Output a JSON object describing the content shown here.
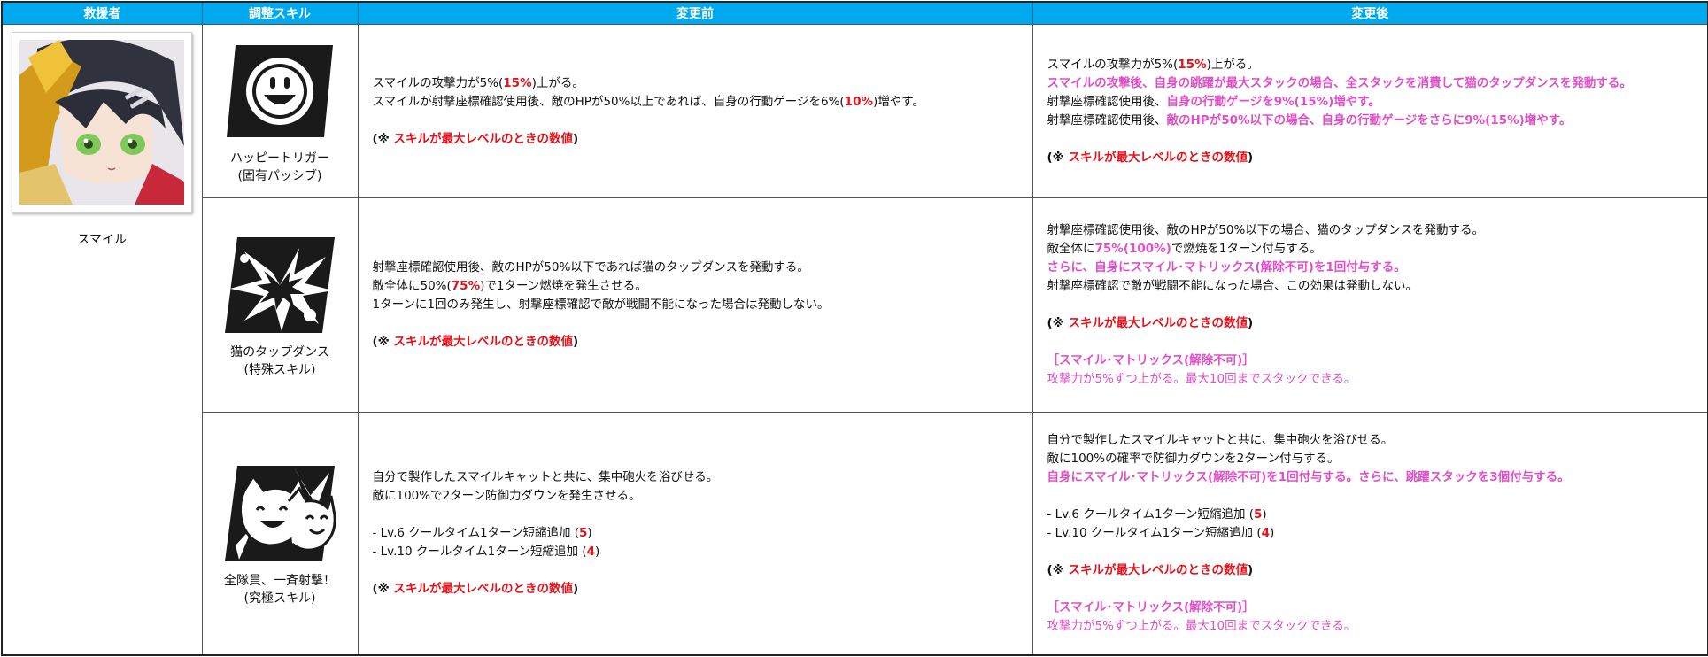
{
  "headers": [
    "救援者",
    "調整スキル",
    "変更前",
    "変更後"
  ],
  "rescuer": {
    "name": "スマイル",
    "portrait": "character-portrait"
  },
  "note": {
    "prefix": "(※ ",
    "emph": "スキルが最大レベルのときの数値",
    "suffix": ")"
  },
  "skills": [
    {
      "icon": "smiley-icon",
      "name": "ハッピートリガー",
      "type": "(固有パッシブ)",
      "before": [
        [
          "スマイルの攻撃力が5%(",
          "15%",
          ")上がる。"
        ],
        [
          "スマイルが射撃座標確認使用後、敵のHPが50%以上であれば、自身の行動ゲージを6%(",
          "10%",
          ")増やす。"
        ]
      ],
      "after": [
        [
          "スマイルの攻撃力が5%(",
          "15%",
          ")上がる。"
        ],
        "スマイルの攻撃後、自身の跳躍が最大スタックの場合、全スタックを消費して猫のタップダンスを発動する。",
        [
          "射撃座標確認使用後、",
          "自身の行動ゲージを9%(15%)増やす。"
        ],
        [
          "射撃座標確認使用後、",
          "敵のHPが50%以下の場合、自身の行動ゲージをさらに9%(15%)増やす。"
        ]
      ]
    },
    {
      "icon": "burst-icon",
      "name": "猫のタップダンス",
      "type": "(特殊スキル)",
      "before": [
        "射撃座標確認使用後、敵のHPが50%以下であれば猫のタップダンスを発動する。",
        [
          "敵全体に50%(",
          "75%",
          ")で1ターン燃焼を発生させる。"
        ],
        "1ターンに1回のみ発生し、射撃座標確認で敵が戦闘不能になった場合は発動しない。"
      ],
      "after": [
        "射撃座標確認使用後、敵のHPが50%以下の場合、猫のタップダンスを発動する。",
        [
          "敵全体に",
          "75%(100%)",
          "で燃焼を1ターン付与する。"
        ],
        "さらに、自身にスマイル･マトリックス(解除不可)を1回付与する。",
        "射撃座標確認で敵が戦闘不能になった場合、この効果は発動しない。"
      ],
      "after_extra": {
        "title": "［スマイル･マトリックス(解除不可)］",
        "desc": "攻撃力が5%ずつ上がる。最大10回までスタックできる。"
      }
    },
    {
      "icon": "cats-icon",
      "name": "全隊員、一斉射撃！",
      "type": "(究極スキル)",
      "before": [
        "自分で製作したスマイルキャットと共に、集中砲火を浴びせる。",
        "敵に100%で2ターン防御力ダウンを発生させる。",
        "",
        [
          "- Lv.6 クールタイム1ターン短縮追加 (",
          "5",
          ")"
        ],
        [
          "- Lv.10  クールタイム1ターン短縮追加 (",
          "4",
          ")"
        ]
      ],
      "after": [
        "自分で製作したスマイルキャットと共に、集中砲火を浴びせる。",
        "敵に100%の確率で防御力ダウンを2ターン付与する。",
        "自身にスマイル･マトリックス(解除不可)を1回付与する。さらに、跳躍スタックを3個付与する。",
        "",
        [
          "- Lv.6 クールタイム1ターン短縮追加 (",
          "5",
          ")"
        ],
        [
          "- Lv.10  クールタイム1ターン短縮追加 (",
          "4",
          ")"
        ]
      ],
      "after_extra": {
        "title": "［スマイル･マトリックス(解除不可)］",
        "desc": "攻撃力が5%ずつ上がる。最大10回までスタックできる。"
      }
    }
  ]
}
